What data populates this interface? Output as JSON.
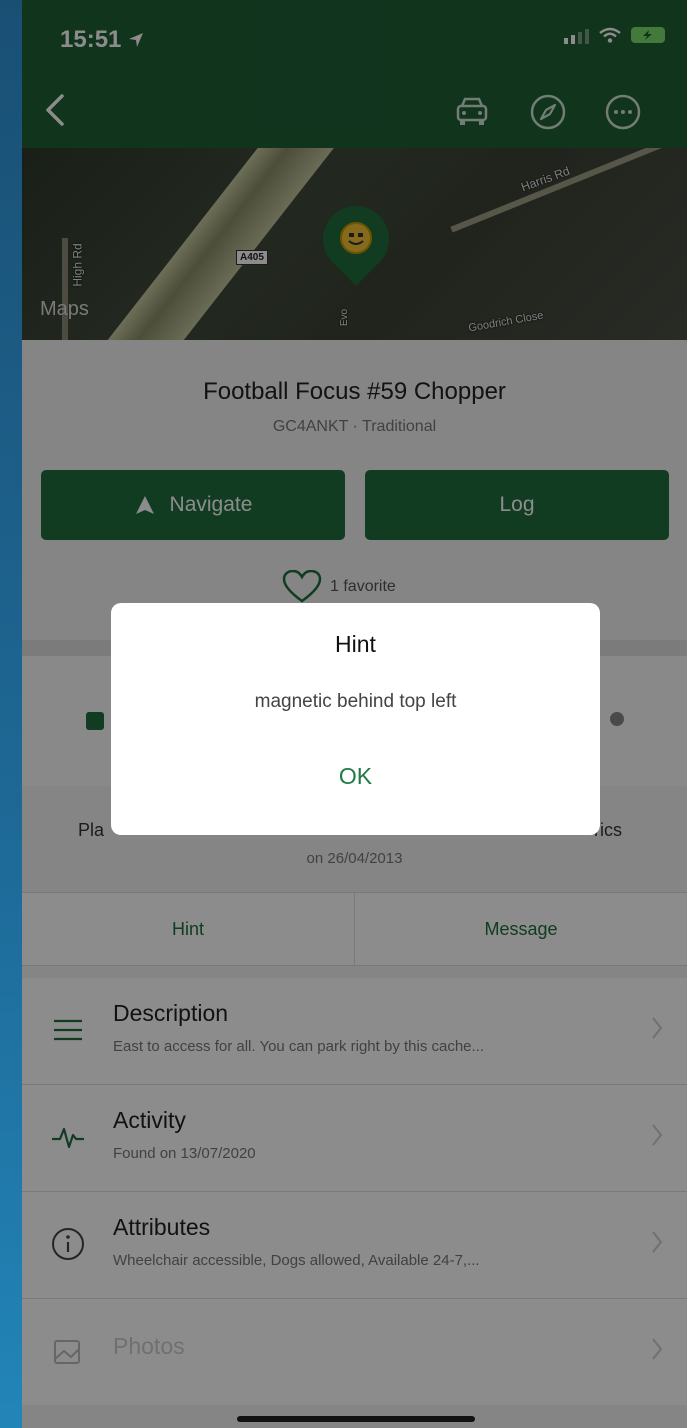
{
  "status": {
    "time": "15:51",
    "location_icon": "location-arrow-icon"
  },
  "header": {
    "back_icon": "chevron-left-icon",
    "actions": [
      "car-icon",
      "compass-icon",
      "more-icon"
    ]
  },
  "map": {
    "labels": [
      "High Rd",
      "Harris Rd",
      "A405",
      "Evo",
      "Goodrich Close"
    ],
    "provider": "Maps"
  },
  "cache": {
    "title": "Football Focus #59 Chopper",
    "subtitle": "GC4ANKT · Traditional",
    "navigate_label": "Navigate",
    "log_label": "Log",
    "favorites": "1 favorite"
  },
  "placed": {
    "prefix": "Pla",
    "suffix": "rics",
    "date": "on 26/04/2013"
  },
  "tabs": [
    "Hint",
    "Message"
  ],
  "list": [
    {
      "title": "Description",
      "subtitle": "East to access for all. You can park right by this cache...",
      "icon": "menu-lines-icon"
    },
    {
      "title": "Activity",
      "subtitle": "Found on 13/07/2020",
      "icon": "activity-pulse-icon"
    },
    {
      "title": "Attributes",
      "subtitle": "Wheelchair accessible, Dogs allowed, Available 24-7,...",
      "icon": "info-circle-icon"
    },
    {
      "title": "Photos",
      "subtitle": "",
      "icon": "photos-icon"
    }
  ],
  "dialog": {
    "title": "Hint",
    "message": "magnetic behind top left",
    "ok_label": "OK"
  },
  "colors": {
    "header": "#1f5f36",
    "accent": "#1f6e3e",
    "ok_text": "#1f7a45"
  }
}
